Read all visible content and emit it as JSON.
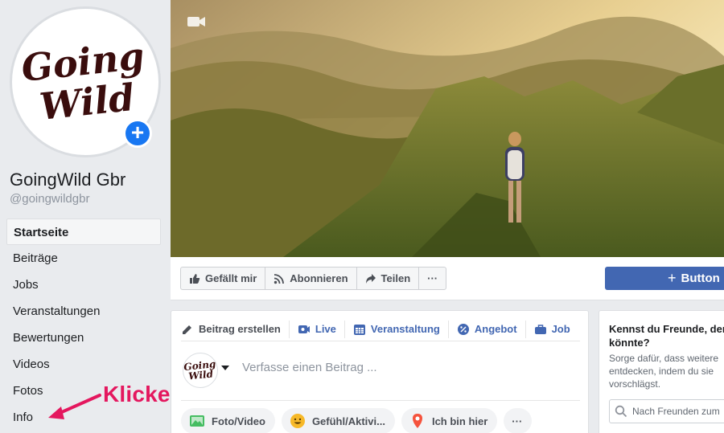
{
  "page": {
    "logo_text": "Going Wild",
    "name": "GoingWild Gbr",
    "handle": "@goingwildgbr"
  },
  "sidebar": {
    "items": [
      {
        "label": "Startseite",
        "active": true
      },
      {
        "label": "Beiträge"
      },
      {
        "label": "Jobs"
      },
      {
        "label": "Veranstaltungen"
      },
      {
        "label": "Bewertungen"
      },
      {
        "label": "Videos"
      },
      {
        "label": "Fotos"
      },
      {
        "label": "Info"
      }
    ]
  },
  "annotation": {
    "text": "Klicke auf „Info“",
    "color": "#e4175e"
  },
  "action_bar": {
    "like": "Gefällt mir",
    "follow": "Abonnieren",
    "share": "Teilen",
    "more": "···",
    "primary_button": "Button"
  },
  "composer": {
    "tabs": [
      "Beitrag erstellen",
      "Live",
      "Veranstaltung",
      "Angebot",
      "Job"
    ],
    "placeholder": "Verfasse einen Beitrag ...",
    "chips": [
      "Foto/Video",
      "Gefühl/Aktivi...",
      "Ich bin hier",
      "···"
    ]
  },
  "friends_box": {
    "title": "Kennst du Freunde, der könnte?",
    "text": "Sorge dafür, dass weitere entdecken, indem du sie vorschlägst.",
    "search_placeholder": "Nach Freunden zum"
  },
  "colors": {
    "accent": "#4267b2",
    "brand_blue": "#1877f2",
    "background": "#e9ebee"
  },
  "icons": [
    "plus-icon",
    "video-camera-icon",
    "thumbs-up-icon",
    "rss-icon",
    "share-arrow-icon",
    "pencil-icon",
    "live-video-icon",
    "calendar-icon",
    "offer-badge-icon",
    "briefcase-icon",
    "photo-icon",
    "smiley-icon",
    "location-pin-icon",
    "search-icon"
  ]
}
